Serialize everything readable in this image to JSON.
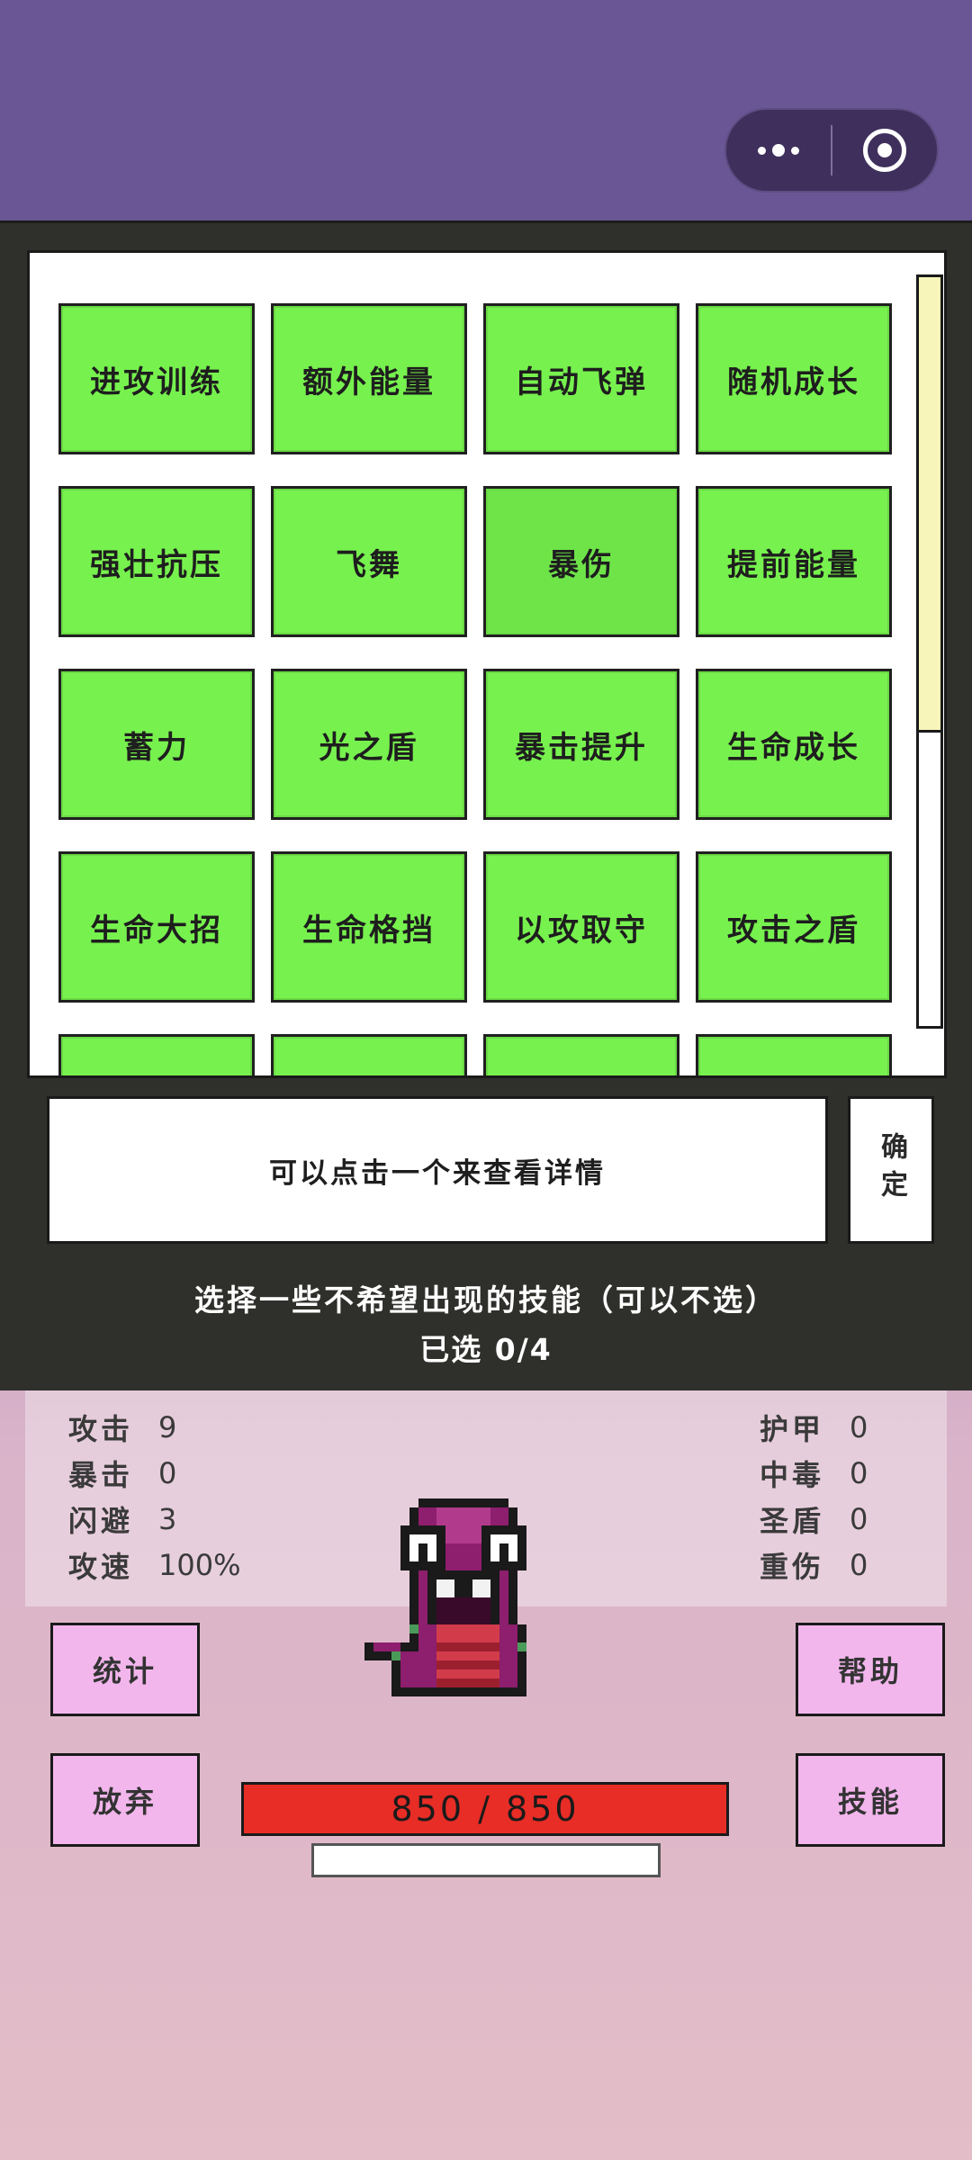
{
  "skills": {
    "row1": [
      "进攻训练",
      "额外能量",
      "自动飞弹",
      "随机成长"
    ],
    "row2": [
      "强壮抗压",
      "飞舞",
      "暴伤",
      "提前能量"
    ],
    "row3": [
      "蓄力",
      "光之盾",
      "暴击提升",
      "生命成长"
    ],
    "row4": [
      "生命大招",
      "生命格挡",
      "以攻取守",
      "攻击之盾"
    ]
  },
  "detail_text": "可以点击一个来查看详情",
  "confirm_label": "确定",
  "prompt": "选择一些不希望出现的技能（可以不选）",
  "selected_count": "已选 0/4",
  "stats_left": [
    {
      "k": "攻击",
      "v": "9"
    },
    {
      "k": "暴击",
      "v": "0"
    },
    {
      "k": "闪避",
      "v": "3"
    },
    {
      "k": "攻速",
      "v": "100%"
    }
  ],
  "stats_right": [
    {
      "k": "护甲",
      "v": "0"
    },
    {
      "k": "中毒",
      "v": "0"
    },
    {
      "k": "圣盾",
      "v": "0"
    },
    {
      "k": "重伤",
      "v": "0"
    }
  ],
  "buttons": {
    "stats": "统计",
    "giveup": "放弃",
    "help": "帮助",
    "skills": "技能"
  },
  "hp": {
    "current": "850",
    "max": "850",
    "text": "850 / 850",
    "fraction": 1.0
  },
  "exp_fraction": 0,
  "colors": {
    "tile_green": "#77f14e",
    "hp_red": "#e72d26",
    "button_pink": "#f2b6ec",
    "panel_dark": "#2f2f2b"
  }
}
